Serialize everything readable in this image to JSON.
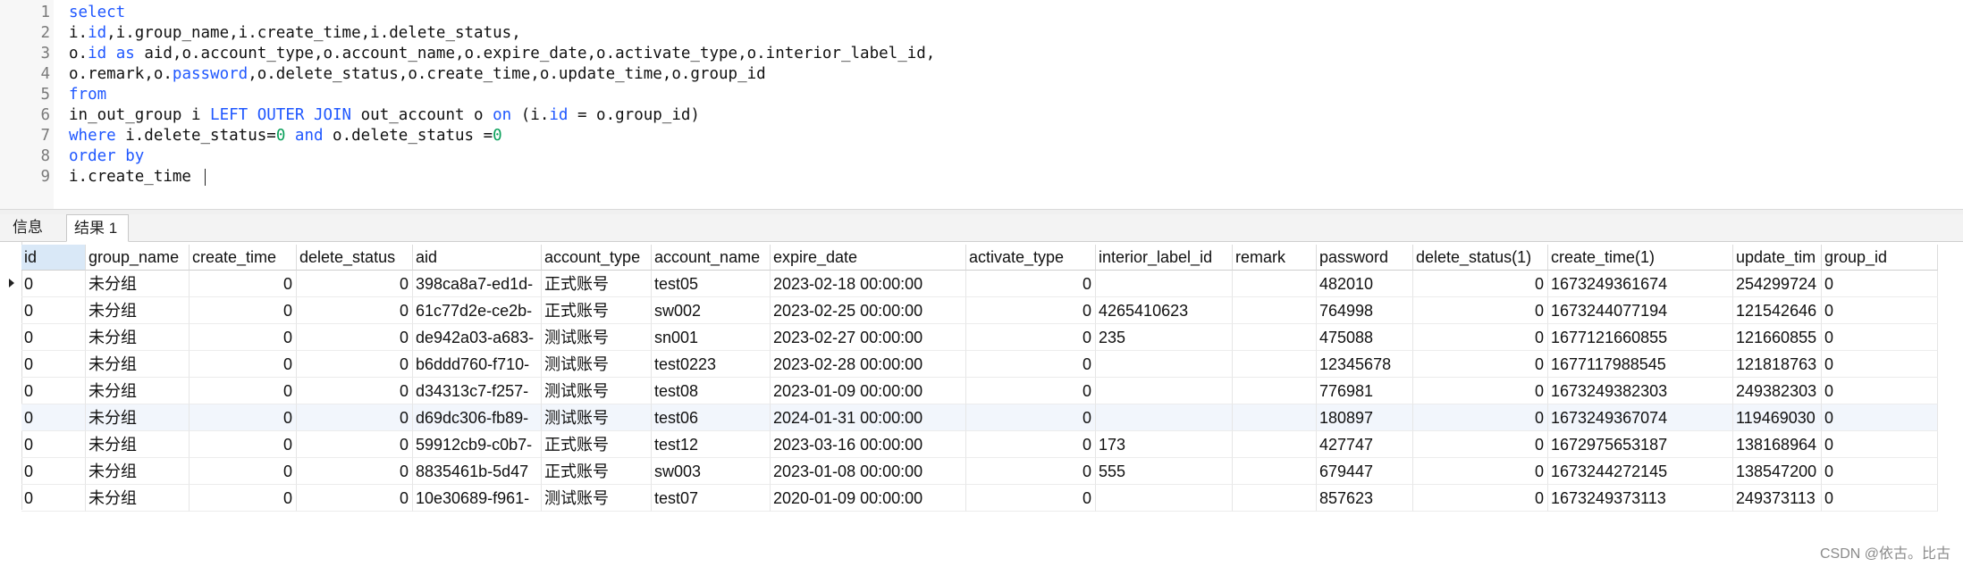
{
  "editor": {
    "lines": [
      {
        "num": "1",
        "tokens": [
          {
            "t": "select",
            "c": "kw"
          }
        ]
      },
      {
        "num": "2",
        "tokens": [
          {
            "t": "i.",
            "c": ""
          },
          {
            "t": "id",
            "c": "kw"
          },
          {
            "t": ",i.group_name,i.create_time,i.delete_status,",
            "c": ""
          }
        ]
      },
      {
        "num": "3",
        "tokens": [
          {
            "t": "o.",
            "c": ""
          },
          {
            "t": "id",
            "c": "kw"
          },
          {
            "t": " ",
            "c": ""
          },
          {
            "t": "as",
            "c": "kw"
          },
          {
            "t": " aid,o.account_type,o.account_name,o.expire_date,o.activate_type,o.interior_label_id,",
            "c": ""
          }
        ]
      },
      {
        "num": "4",
        "tokens": [
          {
            "t": "o.remark,o.",
            "c": ""
          },
          {
            "t": "password",
            "c": "kw"
          },
          {
            "t": ",o.delete_status,o.create_time,o.update_time,o.group_id",
            "c": ""
          }
        ]
      },
      {
        "num": "5",
        "tokens": [
          {
            "t": "from",
            "c": "kw"
          }
        ]
      },
      {
        "num": "6",
        "tokens": [
          {
            "t": "in_out_group i ",
            "c": ""
          },
          {
            "t": "LEFT OUTER JOIN",
            "c": "kw"
          },
          {
            "t": " out_account o ",
            "c": ""
          },
          {
            "t": "on",
            "c": "kw"
          },
          {
            "t": " (i.",
            "c": ""
          },
          {
            "t": "id",
            "c": "kw"
          },
          {
            "t": " = o.group_id)",
            "c": ""
          }
        ]
      },
      {
        "num": "7",
        "tokens": [
          {
            "t": "where",
            "c": "kw"
          },
          {
            "t": " i.delete_status=",
            "c": ""
          },
          {
            "t": "0",
            "c": "num"
          },
          {
            "t": " ",
            "c": ""
          },
          {
            "t": "and",
            "c": "kw"
          },
          {
            "t": " o.delete_status =",
            "c": ""
          },
          {
            "t": "0",
            "c": "num"
          }
        ]
      },
      {
        "num": "8",
        "tokens": [
          {
            "t": "order by",
            "c": "kw"
          }
        ]
      },
      {
        "num": "9",
        "tokens": [
          {
            "t": "i.create_time ",
            "c": ""
          }
        ]
      }
    ]
  },
  "tabs": [
    {
      "label": "信息",
      "active": false
    },
    {
      "label": "结果 1",
      "active": true
    }
  ],
  "table": {
    "columns": [
      "id",
      "group_name",
      "create_time",
      "delete_status",
      "aid",
      "account_type",
      "account_name",
      "expire_date",
      "activate_type",
      "interior_label_id",
      "remark",
      "password",
      "delete_status(1)",
      "create_time(1)",
      "update_time",
      "group_id"
    ],
    "columns_visible": [
      "id",
      "group_name",
      "create_time",
      "delete_status",
      "aid",
      "account_type",
      "account_name",
      "expire_date",
      "activate_type",
      "interior_label_id",
      "remark",
      "password",
      "delete_status(1)",
      "create_time(1)",
      "update_tim",
      "group_id"
    ],
    "rows": [
      [
        "0",
        "未分组",
        "0",
        "0",
        "398ca8a7-ed1d-",
        "正式账号",
        "test05",
        "2023-02-18 00:00:00",
        "0",
        "",
        "",
        "482010",
        "0",
        "1673249361674",
        "254299724",
        "0"
      ],
      [
        "0",
        "未分组",
        "0",
        "0",
        "61c77d2e-ce2b-",
        "正式账号",
        "sw002",
        "2023-02-25 00:00:00",
        "0",
        "4265410623",
        "",
        "764998",
        "0",
        "1673244077194",
        "121542646",
        "0"
      ],
      [
        "0",
        "未分组",
        "0",
        "0",
        "de942a03-a683-",
        "测试账号",
        "sn001",
        "2023-02-27 00:00:00",
        "0",
        "235",
        "",
        "475088",
        "0",
        "1677121660855",
        "121660855",
        "0"
      ],
      [
        "0",
        "未分组",
        "0",
        "0",
        "b6ddd760-f710-",
        "测试账号",
        "test0223",
        "2023-02-28 00:00:00",
        "0",
        "",
        "",
        "12345678",
        "0",
        "1677117988545",
        "121818763",
        "0"
      ],
      [
        "0",
        "未分组",
        "0",
        "0",
        "d34313c7-f257-",
        "测试账号",
        "test08",
        "2023-01-09 00:00:00",
        "0",
        "",
        "",
        "776981",
        "0",
        "1673249382303",
        "249382303",
        "0"
      ],
      [
        "0",
        "未分组",
        "0",
        "0",
        "d69dc306-fb89-",
        "测试账号",
        "test06",
        "2024-01-31 00:00:00",
        "0",
        "",
        "",
        "180897",
        "0",
        "1673249367074",
        "119469030",
        "0"
      ],
      [
        "0",
        "未分组",
        "0",
        "0",
        "59912cb9-c0b7-",
        "正式账号",
        "test12",
        "2023-03-16 00:00:00",
        "0",
        "173",
        "",
        "427747",
        "0",
        "1672975653187",
        "138168964",
        "0"
      ],
      [
        "0",
        "未分组",
        "0",
        "0",
        "8835461b-5d47",
        "正式账号",
        "sw003",
        "2023-01-08 00:00:00",
        "0",
        "555",
        "",
        "679447",
        "0",
        "1673244272145",
        "138547200",
        "0"
      ],
      [
        "0",
        "未分组",
        "0",
        "0",
        "10e30689-f961-",
        "测试账号",
        "test07",
        "2020-01-09 00:00:00",
        "0",
        "",
        "",
        "857623",
        "0",
        "1673249373113",
        "249373113",
        "0"
      ]
    ]
  },
  "watermark": "CSDN @依古。比古"
}
